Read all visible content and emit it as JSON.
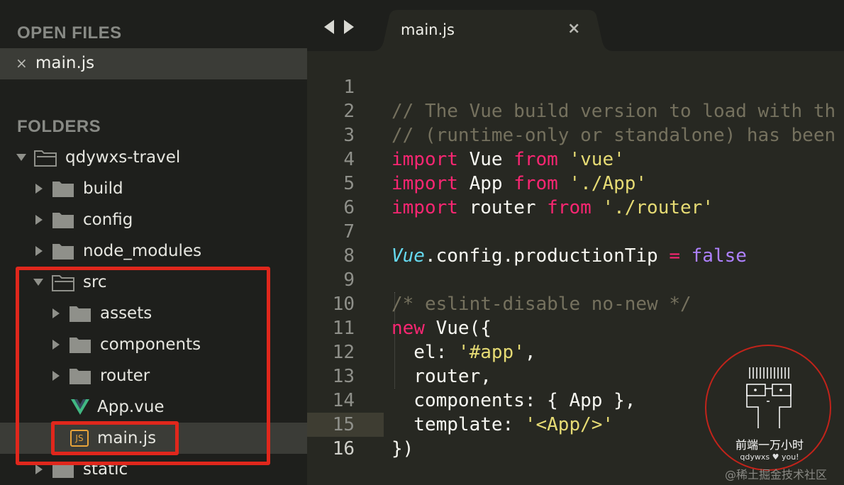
{
  "sidebar": {
    "open_files_header": "OPEN FILES",
    "open_files": [
      {
        "close": "×",
        "name": "main.js"
      }
    ],
    "folders_header": "FOLDERS",
    "tree": {
      "root": "qdywxs-travel",
      "build": "build",
      "config": "config",
      "node_modules": "node_modules",
      "src": "src",
      "assets": "assets",
      "components": "components",
      "router": "router",
      "app_vue": "App.vue",
      "main_js": "main.js",
      "static": "static"
    },
    "js_badge": "JS"
  },
  "tabs": [
    {
      "label": "main.js",
      "close": "×",
      "active": true
    }
  ],
  "editor": {
    "active_line": 16,
    "lines": [
      {
        "n": "1",
        "t": [
          "// The Vue build version to load with th"
        ]
      },
      {
        "n": "2",
        "t": [
          "// (runtime-only or standalone) has been"
        ]
      },
      {
        "n": "3",
        "t": [
          "import",
          " Vue ",
          "from",
          " ",
          "'vue'"
        ]
      },
      {
        "n": "4",
        "t": [
          "import",
          " App ",
          "from",
          " ",
          "'./App'"
        ]
      },
      {
        "n": "5",
        "t": [
          "import",
          " router ",
          "from",
          " ",
          "'./router'"
        ]
      },
      {
        "n": "6",
        "t": []
      },
      {
        "n": "7",
        "t": [
          "Vue",
          ".config.productionTip ",
          "=",
          " ",
          "false"
        ]
      },
      {
        "n": "8",
        "t": []
      },
      {
        "n": "9",
        "t": [
          "/* eslint-disable no-new */"
        ]
      },
      {
        "n": "10",
        "t": [
          "new",
          " Vue({"
        ]
      },
      {
        "n": "11",
        "t": [
          "  el: ",
          "'#app'",
          ","
        ]
      },
      {
        "n": "12",
        "t": [
          "  router,"
        ]
      },
      {
        "n": "13",
        "t": [
          "  components: { App },"
        ]
      },
      {
        "n": "14",
        "t": [
          "  template: ",
          "'<App/>'"
        ]
      },
      {
        "n": "15",
        "t": [
          "})"
        ]
      },
      {
        "n": "16",
        "t": []
      }
    ]
  },
  "watermark_badge": {
    "title": "前端一万小时",
    "subtitle": "qdywxs ♥ you!"
  },
  "watermark_text": "@稀土掘金技术社区",
  "colors": {
    "comment": "#75715e",
    "keyword": "#f92672",
    "string": "#e6db74",
    "class": "#66d9ef",
    "constant": "#ae81ff",
    "highlight_box": "#e0271c",
    "vue_green": "#41b883"
  }
}
